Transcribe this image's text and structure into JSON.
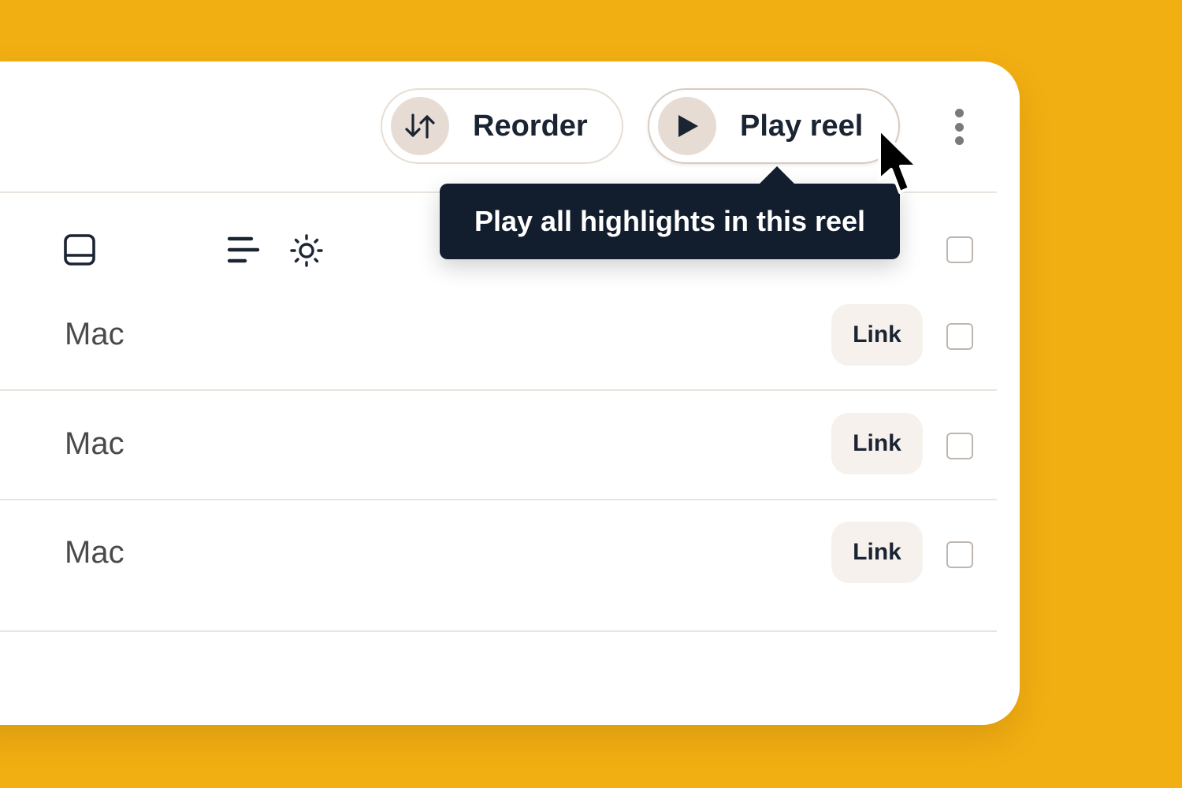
{
  "colors": {
    "background": "#F2AF12",
    "card": "#FFFFFF",
    "tooltip_bg": "#121D2D",
    "text_primary": "#1B2433",
    "pill_circle": "#E7DCD4",
    "link_bg": "#F6F1EC"
  },
  "toolbar": {
    "reorder": {
      "label": "Reorder",
      "icon": "arrows-up-down-icon"
    },
    "play": {
      "label": "Play reel",
      "icon": "play-icon"
    },
    "more": {
      "icon": "kebab-menu-icon"
    }
  },
  "tooltip": {
    "text": "Play all highlights in this reel"
  },
  "header_icons": [
    {
      "icon": "panel-bottom-icon"
    },
    {
      "icon": "align-left-icon"
    },
    {
      "icon": "sun-icon"
    }
  ],
  "rows": [
    {
      "label": "Mac",
      "link_label": "Link"
    },
    {
      "label": "Mac",
      "link_label": "Link"
    },
    {
      "label": "Mac",
      "link_label": "Link"
    }
  ]
}
